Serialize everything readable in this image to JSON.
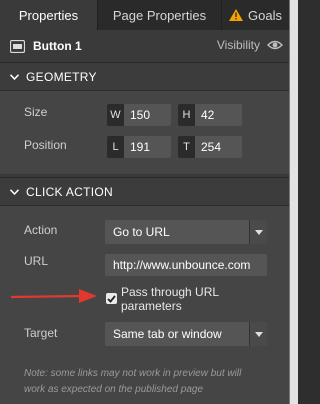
{
  "tabs": [
    {
      "label": "Properties"
    },
    {
      "label": "Page Properties"
    },
    {
      "label": "Goals"
    }
  ],
  "element": {
    "title": "Button 1",
    "visibility_label": "Visibility"
  },
  "geometry": {
    "title": "GEOMETRY",
    "size_label": "Size",
    "position_label": "Position",
    "w_key": "W",
    "w_val": "150",
    "h_key": "H",
    "h_val": "42",
    "l_key": "L",
    "l_val": "191",
    "t_key": "T",
    "t_val": "254"
  },
  "click_action": {
    "title": "CLICK ACTION",
    "action_label": "Action",
    "action_value": "Go to URL",
    "url_label": "URL",
    "url_value": "http://www.unbounce.com",
    "pass_through_line1": "Pass through URL",
    "pass_through_line2": "parameters",
    "pass_through_checked": true,
    "target_label": "Target",
    "target_value": "Same tab or window",
    "note_line1": "Note: some links may not work in preview but will",
    "note_line2": "work as expected on the published page"
  },
  "colors": {
    "accent_arrow": "#e03a2e",
    "warning": "#f4a300"
  },
  "icons": [
    "warning-icon",
    "button-element-icon",
    "eye-icon",
    "chevron-down-icon",
    "checkmark-icon"
  ]
}
